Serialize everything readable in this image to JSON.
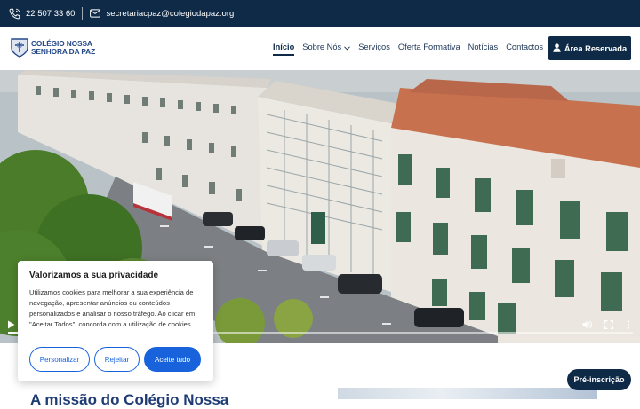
{
  "topbar": {
    "phone": "22 507 33 60",
    "email": "secretariacpaz@colegiodapaz.org",
    "phone_icon": "phone-icon",
    "email_icon": "mail-icon"
  },
  "brand": {
    "line1": "COLÉGIO NOSSA",
    "line2": "SENHORA DA PAZ"
  },
  "nav": {
    "items": [
      {
        "label": "Início",
        "active": true
      },
      {
        "label": "Sobre Nós",
        "dropdown": true
      },
      {
        "label": "Serviços"
      },
      {
        "label": "Oferta Formativa"
      },
      {
        "label": "Notícias"
      },
      {
        "label": "Contactos"
      }
    ],
    "reserved_label": "Área Reservada"
  },
  "video": {
    "progress_fraction": 0.02
  },
  "cookie": {
    "title": "Valorizamos a sua privacidade",
    "text": "Utilizamos cookies para melhorar a sua experiência de navegação, apresentar anúncios ou conteúdos personalizados e analisar o nosso tráfego. Ao clicar em \"Aceitar Todos\", concorda com a utilização de cookies.",
    "customize": "Personalizar",
    "reject": "Rejeitar",
    "accept": "Aceite tudo"
  },
  "section": {
    "heading": "A missão do Colégio Nossa"
  },
  "floating": {
    "preinscription": "Pré-inscrição"
  },
  "colors": {
    "navy": "#0e2a47",
    "accent_blue": "#1863dc",
    "brand_blue": "#25498a"
  }
}
